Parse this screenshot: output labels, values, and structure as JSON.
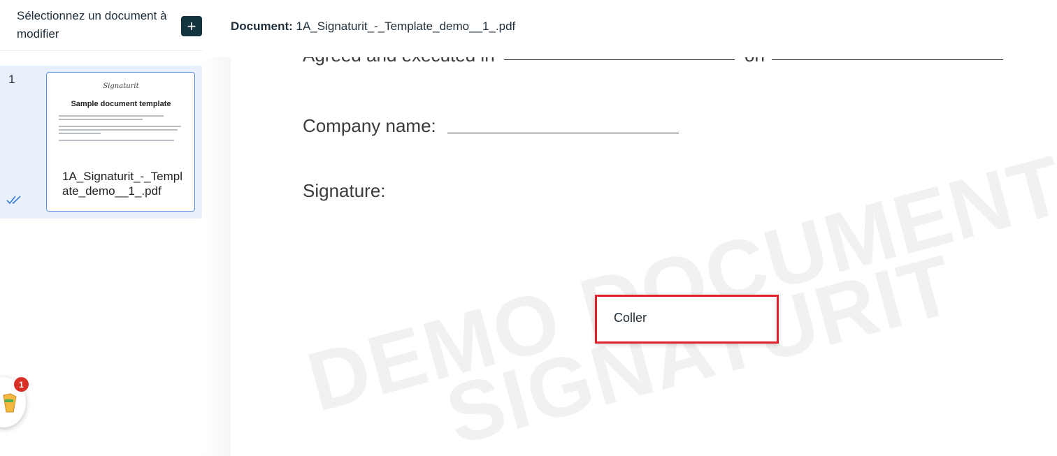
{
  "sidebar": {
    "title": "Sélectionnez un document à modifier",
    "add_label": "+",
    "items": [
      {
        "index": "1",
        "filename": "1A_Signaturit_-_Template_demo__1_.pdf",
        "thumbnail": {
          "logo": "Signaturit",
          "title": "Sample document template"
        }
      }
    ]
  },
  "header": {
    "label": "Document:",
    "filename": "1A_Signaturit_-_Template_demo__1_.pdf"
  },
  "document": {
    "line1_prefix": "Agreed and executed in",
    "line1_mid": "on",
    "company_label": "Company name:",
    "signature_label": "Signature:",
    "watermark_line1": "DEMO DOCUMENT",
    "watermark_line2": "SIGNATURIT"
  },
  "context_menu": {
    "items": [
      "Coller"
    ]
  },
  "notification_widget": {
    "badge_count": "1"
  },
  "colors": {
    "accent": "#123440",
    "selection_bg": "#e8f0fb",
    "card_border": "#5b93e6",
    "highlight": "#e0202b",
    "badge": "#d93025"
  }
}
